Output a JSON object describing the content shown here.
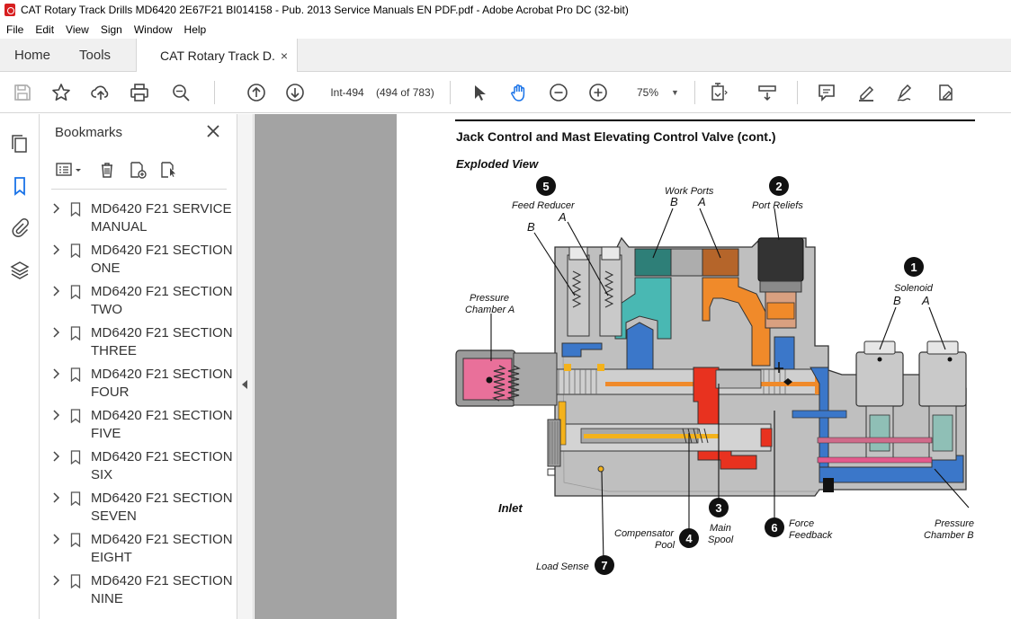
{
  "window": {
    "title": "CAT Rotary Track Drills MD6420 2E67F21 BI014158 - Pub. 2013 Service Manuals EN PDF.pdf - Adobe Acrobat Pro DC (32-bit)"
  },
  "menu": [
    "File",
    "Edit",
    "View",
    "Sign",
    "Window",
    "Help"
  ],
  "tabs": {
    "home": "Home",
    "tools": "Tools",
    "document": "CAT Rotary Track D...",
    "close": "×"
  },
  "toolbar": {
    "page_label": "Int-494",
    "page_count": "(494 of 783)",
    "zoom": "75%",
    "icons": [
      "save-icon",
      "star-icon",
      "upload-icon",
      "print-icon",
      "zoom-search-icon",
      "prev-page-icon",
      "next-page-icon",
      "select-arrow-icon",
      "hand-icon",
      "zoom-out-icon",
      "zoom-in-icon",
      "fit-page-icon",
      "scroll-mode-icon",
      "comment-icon",
      "highlight-icon",
      "sign-icon",
      "fill-sign-icon"
    ]
  },
  "panel": {
    "title": "Bookmarks",
    "close": "×",
    "bookmarks": [
      "MD6420 F21 SERVICE MANUAL",
      "MD6420 F21 SECTION ONE",
      "MD6420 F21 SECTION TWO",
      "MD6420 F21 SECTION THREE",
      "MD6420 F21 SECTION FOUR",
      "MD6420 F21 SECTION FIVE",
      "MD6420 F21 SECTION SIX",
      "MD6420 F21 SECTION SEVEN",
      "MD6420 F21 SECTION EIGHT",
      "MD6420 F21 SECTION NINE"
    ]
  },
  "page": {
    "heading": "Jack Control and Mast Elevating Control Valve (cont.)",
    "subheading": "Exploded View",
    "callouts": {
      "n1": "1",
      "n2": "2",
      "n3": "3",
      "n4": "4",
      "n5": "5",
      "n6": "6",
      "n7": "7",
      "feed_reducer": "Feed Reducer",
      "work_ports": "Work Ports",
      "port_reliefs": "Port Reliefs",
      "solenoid": "Solenoid",
      "pressure_chamber_a_1": "Pressure",
      "pressure_chamber_a_2": "Chamber A",
      "pressure_chamber_b_1": "Pressure",
      "pressure_chamber_b_2": "Chamber B",
      "inlet": "Inlet",
      "compensator_1": "Compensator",
      "compensator_2": "Pool",
      "main_spool_1": "Main",
      "main_spool_2": "Spool",
      "force_feedback_1": "Force",
      "force_feedback_2": "Feedback",
      "load_sense": "Load Sense",
      "a": "A",
      "b": "B"
    }
  },
  "colors": {
    "orange": "#f08a2a",
    "red": "#e8321f",
    "blue": "#3b77c9",
    "teal": "#49b8b3",
    "pink": "#e45a8c",
    "yellow": "#f4b21b",
    "body_gray": "#bdbdbd"
  }
}
